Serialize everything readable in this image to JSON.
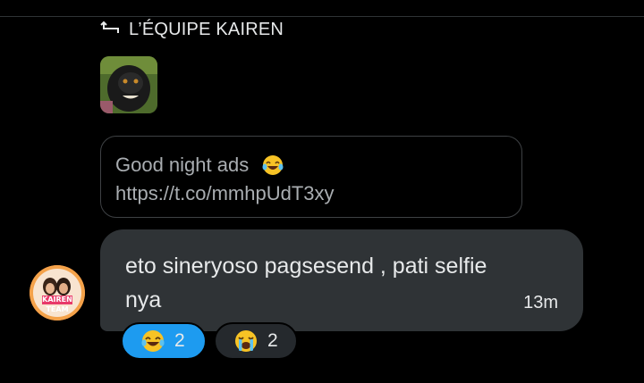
{
  "reply_header": {
    "label": "L’ÉQUIPE KAIREN"
  },
  "quoted_message": {
    "text": "Good night ads",
    "emoji": "laughing-tears-emoji",
    "link": "https://t.co/mmhpUdT3xy"
  },
  "message": {
    "text": "eto sineryoso pagsesend , pati selfie nya",
    "time": "13m"
  },
  "reactions": [
    {
      "emoji": "laughing-tears-emoji",
      "count": "2",
      "active": true
    },
    {
      "emoji": "loudly-crying-emoji",
      "count": "2",
      "active": false
    }
  ],
  "avatar": {
    "text": "KAIREN TEAM"
  },
  "colors": {
    "background": "#000000",
    "bubble": "#2f3336",
    "active_reaction": "#1d9bf0",
    "inactive_reaction": "#25292d",
    "quote_border": "#3e4144"
  }
}
